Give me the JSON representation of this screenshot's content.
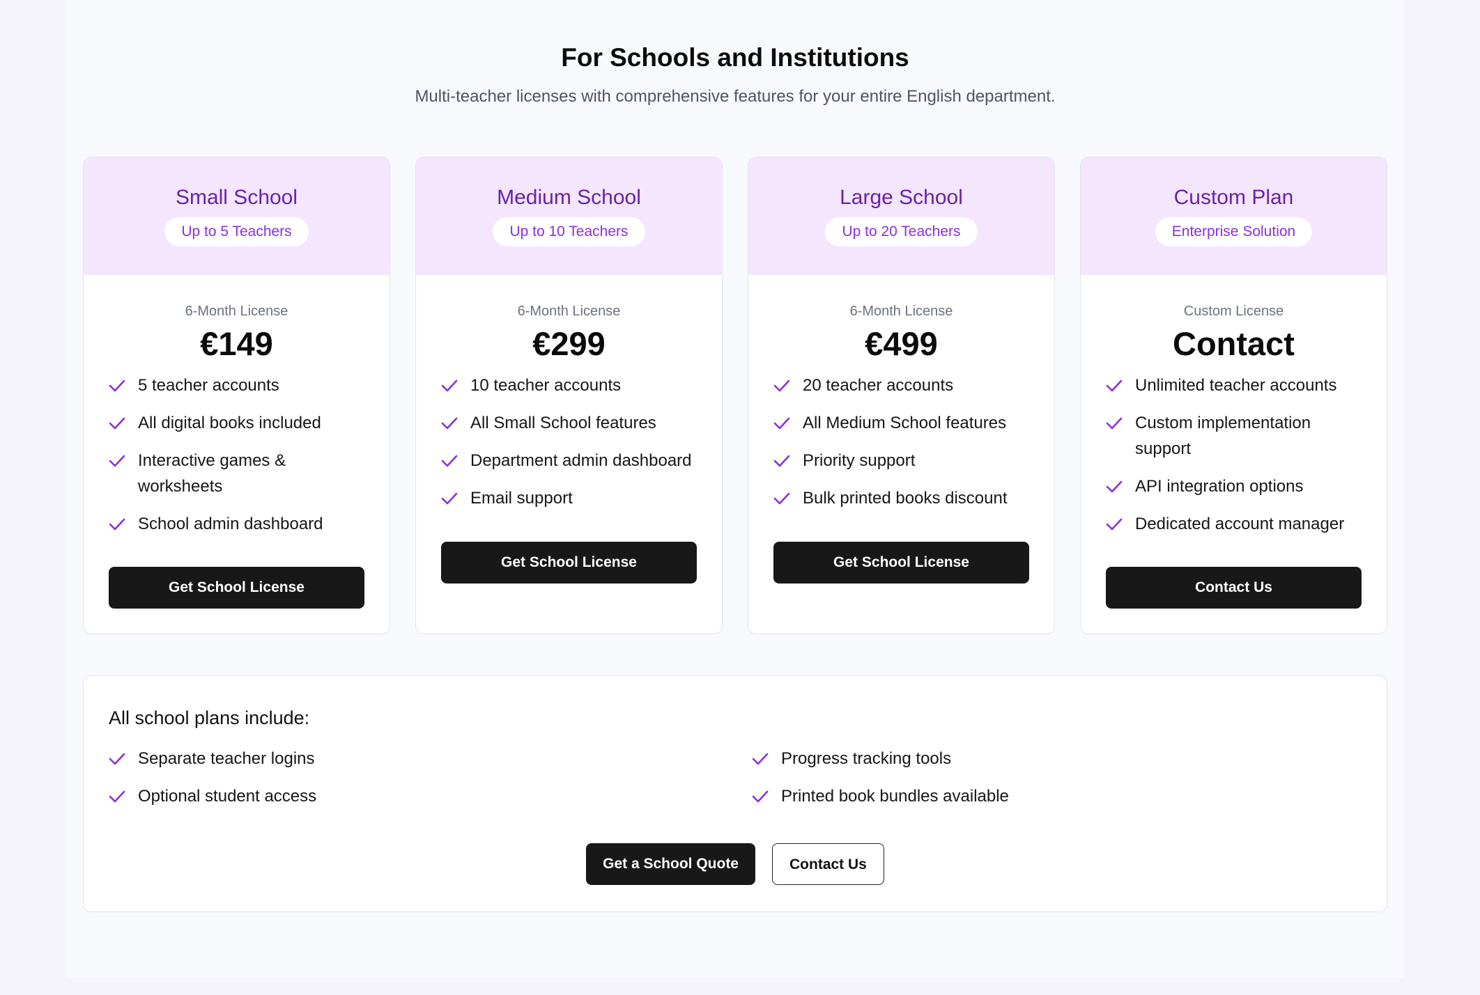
{
  "header": {
    "title": "For Schools and Institutions",
    "subtitle": "Multi-teacher licenses with comprehensive features for your entire English department."
  },
  "colors": {
    "accent": "#8b2ee0",
    "card_head_bg": "#f3e6fd",
    "plan_name": "#6b21a8",
    "button_dark": "#181818"
  },
  "check_icon": "check-icon",
  "plans": [
    {
      "name": "Small School",
      "badge": "Up to 5 Teachers",
      "license": "6-Month License",
      "price": "€149",
      "features": [
        "5 teacher accounts",
        "All digital books included",
        "Interactive games & worksheets",
        "School admin dashboard"
      ],
      "cta": "Get School License"
    },
    {
      "name": "Medium School",
      "badge": "Up to 10 Teachers",
      "license": "6-Month License",
      "price": "€299",
      "features": [
        "10 teacher accounts",
        "All Small School features",
        "Department admin dashboard",
        "Email support"
      ],
      "cta": "Get School License"
    },
    {
      "name": "Large School",
      "badge": "Up to 20 Teachers",
      "license": "6-Month License",
      "price": "€499",
      "features": [
        "20 teacher accounts",
        "All Medium School features",
        "Priority support",
        "Bulk printed books discount"
      ],
      "cta": "Get School License"
    },
    {
      "name": "Custom Plan",
      "badge": "Enterprise Solution",
      "license": "Custom License",
      "price": "Contact",
      "features": [
        "Unlimited teacher accounts",
        "Custom implementation support",
        "API integration options",
        "Dedicated account manager"
      ],
      "cta": "Contact Us"
    }
  ],
  "includes": {
    "title": "All school plans include:",
    "items": [
      "Separate teacher logins",
      "Progress tracking tools",
      "Optional student access",
      "Printed book bundles available"
    ],
    "primary_button": "Get a School Quote",
    "secondary_button": "Contact Us"
  }
}
